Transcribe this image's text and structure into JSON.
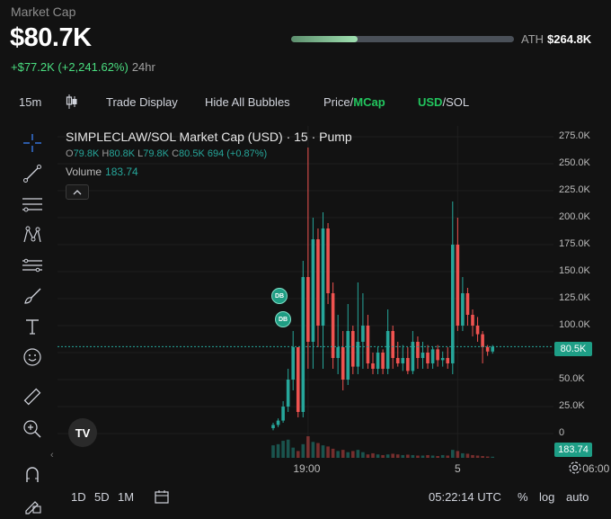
{
  "header": {
    "label": "Market Cap",
    "value": "$80.7K",
    "change": "+$77.2K (+2,241.62%)",
    "change_period": "24hr",
    "ath_label": "ATH",
    "ath_value": "$264.8K",
    "ath_progress": 0.3
  },
  "toolbar": {
    "interval": "15m",
    "trade_display": "Trade Display",
    "hide_bubbles": "Hide All Bubbles",
    "price": "Price",
    "price_sep": "/",
    "mcap": "MCap",
    "usd": "USD",
    "usd_sep": "/",
    "sol": "SOL"
  },
  "left_tools": [
    "crosshair-icon",
    "trendline-icon",
    "horizontal-lines-icon",
    "pattern-icon",
    "ruler-lines-icon",
    "brush-icon",
    "text-icon",
    "emoji-icon",
    "measure-icon",
    "zoom-in-icon",
    "magnet-icon",
    "lock-pencil-icon"
  ],
  "chart": {
    "title": "SIMPLECLAW/SOL Market Cap (USD) · 15 · Pump",
    "ohlc": {
      "o_label": "O",
      "o": "79.8K",
      "h_label": "H",
      "h": "80.8K",
      "l_label": "L",
      "l": "79.8K",
      "c_label": "C",
      "c": "80.5K",
      "vol": "694",
      "chg": "(+0.87%)"
    },
    "volume_label": "Volume",
    "volume_value": "183.74",
    "current_price_tag": "80.5K",
    "volume_tag": "183.74",
    "bubble_label": "DB",
    "logo_text": "TV"
  },
  "chart_data": {
    "type": "candlestick",
    "title": "SIMPLECLAW/SOL Market Cap (USD) · 15 · Pump",
    "ylim": [
      0,
      285000
    ],
    "y_ticks": [
      "275.0K",
      "250.0K",
      "225.0K",
      "200.0K",
      "175.0K",
      "150.0K",
      "125.0K",
      "100.0K",
      "75.0K",
      "50.0K",
      "25.0K",
      "0"
    ],
    "y_tick_values": [
      275000,
      250000,
      225000,
      200000,
      175000,
      150000,
      125000,
      100000,
      75000,
      50000,
      25000,
      0
    ],
    "x_ticks": [
      "19:00",
      "5",
      "06:00"
    ],
    "x_tick_index": [
      7,
      37,
      65
    ],
    "candles": [
      {
        "o": 5000,
        "h": 10000,
        "l": 3000,
        "c": 8000
      },
      {
        "o": 8000,
        "h": 14000,
        "l": 6000,
        "c": 12000
      },
      {
        "o": 12000,
        "h": 30000,
        "l": 10000,
        "c": 25000
      },
      {
        "o": 25000,
        "h": 60000,
        "l": 20000,
        "c": 50000
      },
      {
        "o": 50000,
        "h": 95000,
        "l": 40000,
        "c": 80000
      },
      {
        "o": 80000,
        "h": 75000,
        "l": 15000,
        "c": 20000
      },
      {
        "o": 20000,
        "h": 160000,
        "l": 15000,
        "c": 145000
      },
      {
        "o": 145000,
        "h": 265000,
        "l": 60000,
        "c": 85000
      },
      {
        "o": 85000,
        "h": 200000,
        "l": 60000,
        "c": 180000
      },
      {
        "o": 180000,
        "h": 190000,
        "l": 80000,
        "c": 100000
      },
      {
        "o": 100000,
        "h": 205000,
        "l": 60000,
        "c": 190000
      },
      {
        "o": 190000,
        "h": 195000,
        "l": 120000,
        "c": 130000
      },
      {
        "o": 130000,
        "h": 140000,
        "l": 60000,
        "c": 70000
      },
      {
        "o": 70000,
        "h": 110000,
        "l": 55000,
        "c": 80000
      },
      {
        "o": 80000,
        "h": 95000,
        "l": 40000,
        "c": 50000
      },
      {
        "o": 50000,
        "h": 120000,
        "l": 45000,
        "c": 95000
      },
      {
        "o": 95000,
        "h": 100000,
        "l": 55000,
        "c": 62000
      },
      {
        "o": 62000,
        "h": 140000,
        "l": 55000,
        "c": 85000
      },
      {
        "o": 85000,
        "h": 130000,
        "l": 60000,
        "c": 100000
      },
      {
        "o": 100000,
        "h": 110000,
        "l": 60000,
        "c": 65000
      },
      {
        "o": 65000,
        "h": 75000,
        "l": 55000,
        "c": 60000
      },
      {
        "o": 60000,
        "h": 80000,
        "l": 55000,
        "c": 75000
      },
      {
        "o": 75000,
        "h": 78000,
        "l": 55000,
        "c": 60000
      },
      {
        "o": 60000,
        "h": 115000,
        "l": 55000,
        "c": 95000
      },
      {
        "o": 95000,
        "h": 100000,
        "l": 60000,
        "c": 70000
      },
      {
        "o": 70000,
        "h": 85000,
        "l": 62000,
        "c": 65000
      },
      {
        "o": 65000,
        "h": 82000,
        "l": 58000,
        "c": 70000
      },
      {
        "o": 70000,
        "h": 80000,
        "l": 55000,
        "c": 58000
      },
      {
        "o": 58000,
        "h": 95000,
        "l": 55000,
        "c": 85000
      },
      {
        "o": 85000,
        "h": 90000,
        "l": 60000,
        "c": 70000
      },
      {
        "o": 70000,
        "h": 85000,
        "l": 60000,
        "c": 75000
      },
      {
        "o": 75000,
        "h": 82000,
        "l": 60000,
        "c": 65000
      },
      {
        "o": 65000,
        "h": 80000,
        "l": 60000,
        "c": 78000
      },
      {
        "o": 78000,
        "h": 82000,
        "l": 62000,
        "c": 68000
      },
      {
        "o": 68000,
        "h": 76000,
        "l": 62000,
        "c": 70000
      },
      {
        "o": 70000,
        "h": 80000,
        "l": 60000,
        "c": 65000
      },
      {
        "o": 65000,
        "h": 215000,
        "l": 55000,
        "c": 175000
      },
      {
        "o": 175000,
        "h": 200000,
        "l": 95000,
        "c": 100000
      },
      {
        "o": 100000,
        "h": 145000,
        "l": 95000,
        "c": 130000
      },
      {
        "o": 130000,
        "h": 135000,
        "l": 100000,
        "c": 110000
      },
      {
        "o": 110000,
        "h": 115000,
        "l": 90000,
        "c": 100000
      },
      {
        "o": 100000,
        "h": 108000,
        "l": 85000,
        "c": 92000
      },
      {
        "o": 92000,
        "h": 95000,
        "l": 65000,
        "c": 80000
      },
      {
        "o": 80000,
        "h": 82000,
        "l": 72000,
        "c": 76000
      },
      {
        "o": 76000,
        "h": 82000,
        "l": 74000,
        "c": 80500
      }
    ],
    "volumes": [
      55,
      60,
      75,
      80,
      45,
      30,
      60,
      95,
      70,
      65,
      55,
      50,
      40,
      30,
      35,
      25,
      30,
      35,
      25,
      15,
      20,
      15,
      12,
      15,
      18,
      15,
      12,
      14,
      12,
      10,
      10,
      12,
      10,
      8,
      12,
      10,
      35,
      30,
      20,
      18,
      12,
      10,
      8,
      6,
      5
    ]
  },
  "bottom": {
    "range_1d": "1D",
    "range_5d": "5D",
    "range_1m": "1M",
    "time": "05:22:14 UTC",
    "percent": "%",
    "log": "log",
    "auto": "auto"
  },
  "colors": {
    "up": "#26a69a",
    "down": "#ef5350",
    "accent": "#4ade80",
    "bg": "#121212"
  }
}
